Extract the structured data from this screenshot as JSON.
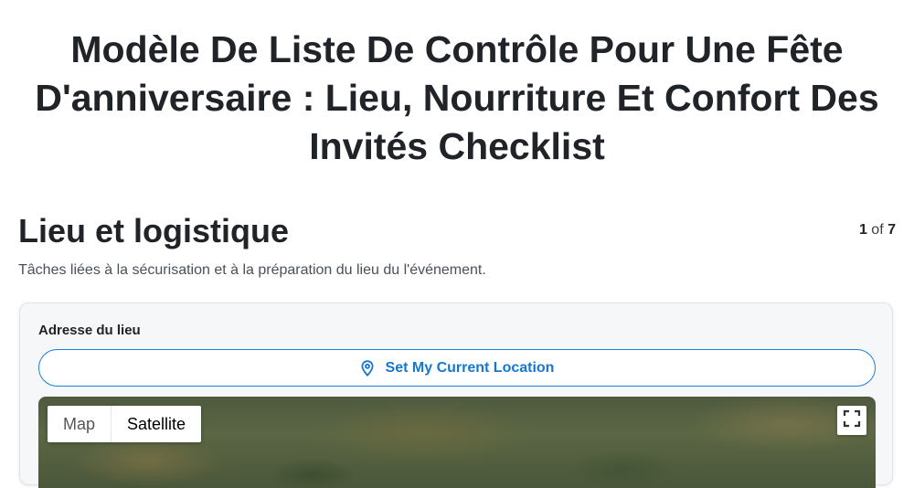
{
  "page": {
    "title": "Modèle De Liste De Contrôle Pour Une Fête D'anniversaire : Lieu, Nourriture Et Confort Des Invités Checklist"
  },
  "section": {
    "title": "Lieu et logistique",
    "description": "Tâches liées à la sécurisation et à la préparation du lieu du l'événement.",
    "pager": {
      "current": "1",
      "of_label": "of",
      "total": "7"
    }
  },
  "venue": {
    "field_label": "Adresse du lieu",
    "location_button_label": "Set My Current Location",
    "location_icon": "map-pin-icon",
    "map": {
      "map_type_label": "Map",
      "satellite_type_label": "Satellite",
      "selected_type": "Satellite",
      "fullscreen_icon": "fullscreen-icon"
    }
  },
  "colors": {
    "accent": "#1677d2",
    "title_text": "#202428"
  }
}
